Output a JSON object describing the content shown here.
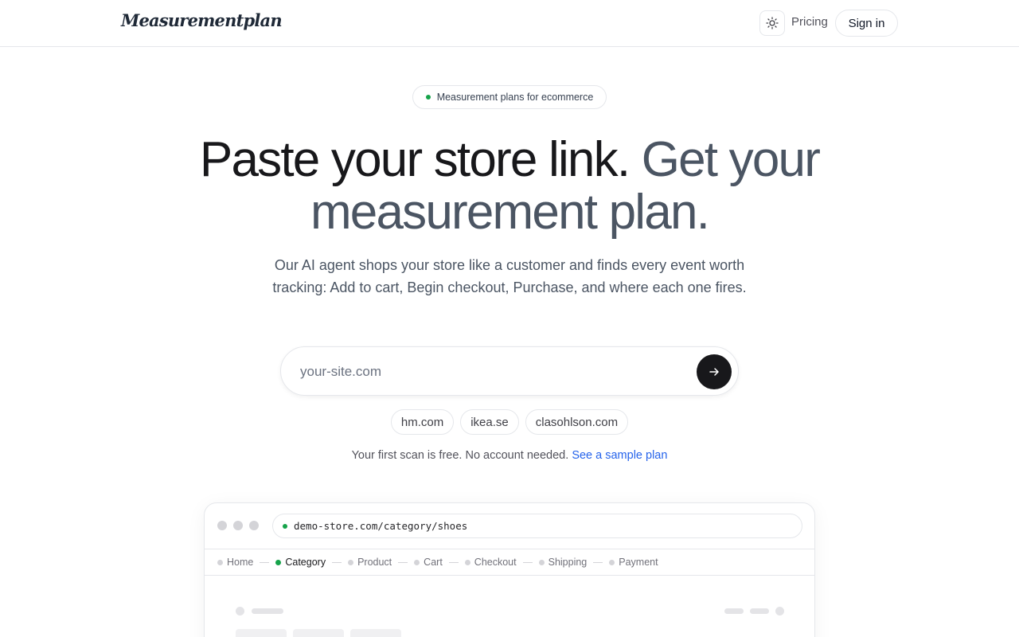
{
  "header": {
    "logo": "Measurementplan",
    "theme_icon": "sun-icon",
    "pricing_label": "Pricing",
    "signin_label": "Sign in"
  },
  "badge": {
    "text": "Measurement plans for ecommerce"
  },
  "hero": {
    "title_main": "Paste your store link.",
    "title_muted": "Get your measurement plan.",
    "subtitle": "Our AI agent shops your store like a customer and finds every event worth tracking: Add to cart, Begin checkout, Purchase, and where each one fires."
  },
  "search": {
    "placeholder": "your-site.com",
    "value": "",
    "submit_icon": "arrow-right-icon"
  },
  "suggestions": [
    "hm.com",
    "ikea.se",
    "clasohlson.com"
  ],
  "note": {
    "text": "Your first scan is free. No account needed.",
    "link": "See a sample plan"
  },
  "preview": {
    "url": "demo-store.com/category/shoes",
    "steps": [
      "Home",
      "Category",
      "Product",
      "Cart",
      "Checkout",
      "Shipping",
      "Payment"
    ],
    "active_step": "Category"
  },
  "colors": {
    "accent_green": "#16a34a",
    "link_blue": "#2563eb",
    "dark": "#18181b"
  }
}
